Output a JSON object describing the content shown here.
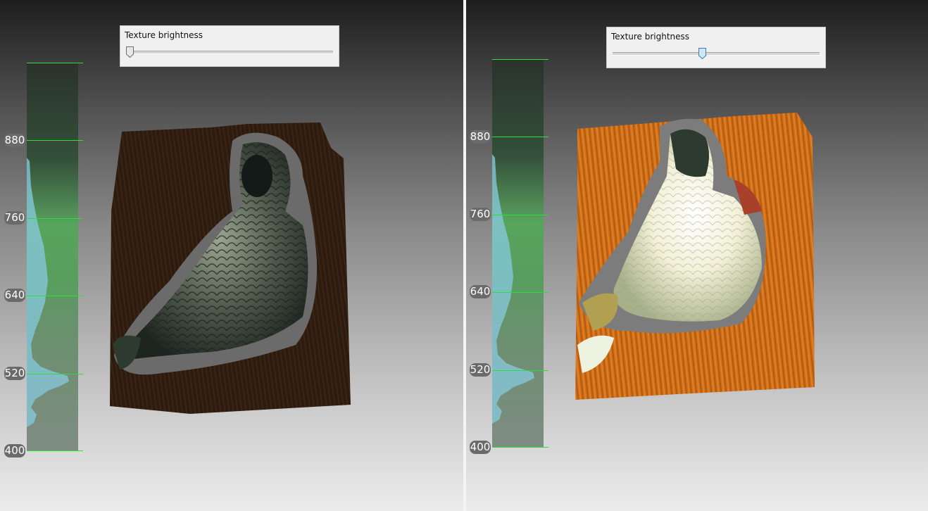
{
  "left_view": {
    "slider": {
      "label": "Texture brightness",
      "value": 0.0
    },
    "depth_ticks": [
      "880",
      "760",
      "640",
      "520",
      "400"
    ]
  },
  "right_view": {
    "slider": {
      "label": "Texture brightness",
      "value": 0.4
    },
    "depth_ticks": [
      "880",
      "760",
      "640",
      "520",
      "400"
    ]
  },
  "colors": {
    "tick_line": "#29e03a",
    "histogram": "#86c7d8",
    "dark_wood": "#2f1d10",
    "bright_wood": "#d9741c"
  },
  "icons": {
    "slider_thumb": "slider-thumb-icon"
  }
}
